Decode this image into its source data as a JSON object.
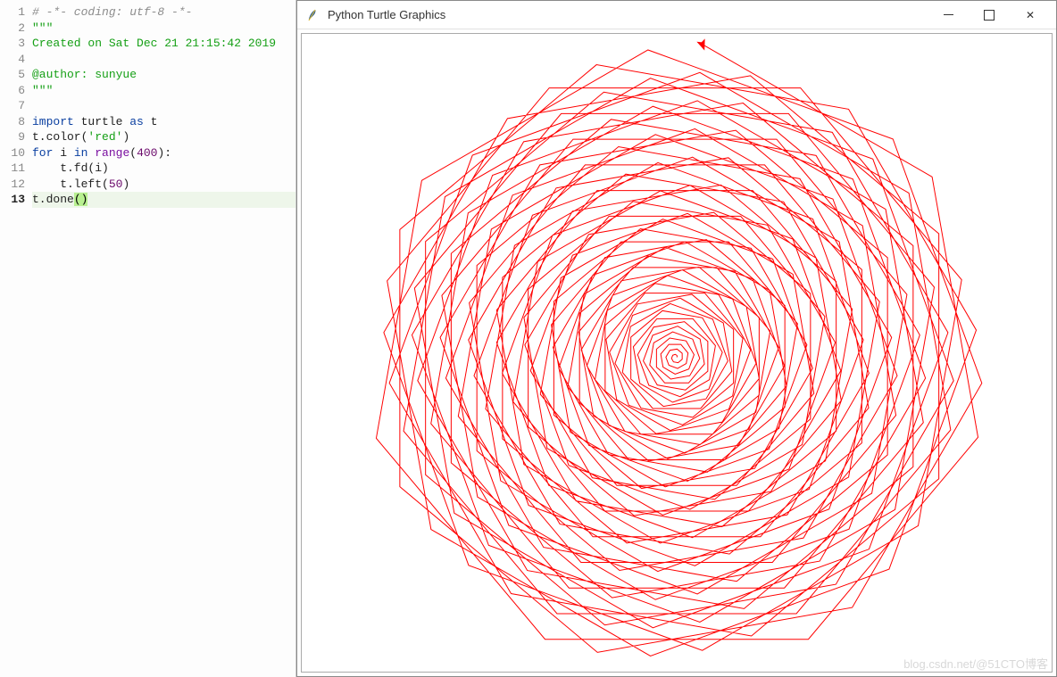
{
  "code": {
    "current_line": 13,
    "lines": [
      {
        "n": 1,
        "segs": [
          {
            "cls": "tk-comment",
            "t": "# -*- coding: utf-8 -*-"
          }
        ]
      },
      {
        "n": 2,
        "segs": [
          {
            "cls": "tk-docstring",
            "t": "\"\"\""
          }
        ]
      },
      {
        "n": 3,
        "segs": [
          {
            "cls": "tk-docstring",
            "t": "Created on Sat Dec 21 21:15:42 2019"
          }
        ]
      },
      {
        "n": 4,
        "segs": []
      },
      {
        "n": 5,
        "segs": [
          {
            "cls": "tk-docstring",
            "t": "@author: sunyue"
          }
        ]
      },
      {
        "n": 6,
        "segs": [
          {
            "cls": "tk-docstring",
            "t": "\"\"\""
          }
        ]
      },
      {
        "n": 7,
        "segs": []
      },
      {
        "n": 8,
        "segs": [
          {
            "cls": "tk-keyword",
            "t": "import"
          },
          {
            "cls": "tk-text",
            "t": " turtle "
          },
          {
            "cls": "tk-keyword",
            "t": "as"
          },
          {
            "cls": "tk-text",
            "t": " t"
          }
        ]
      },
      {
        "n": 9,
        "segs": [
          {
            "cls": "tk-text",
            "t": "t.color("
          },
          {
            "cls": "tk-string",
            "t": "'red'"
          },
          {
            "cls": "tk-text",
            "t": ")"
          }
        ]
      },
      {
        "n": 10,
        "segs": [
          {
            "cls": "tk-keyword",
            "t": "for"
          },
          {
            "cls": "tk-text",
            "t": " i "
          },
          {
            "cls": "tk-keyword",
            "t": "in"
          },
          {
            "cls": "tk-text",
            "t": " "
          },
          {
            "cls": "tk-builtin",
            "t": "range"
          },
          {
            "cls": "tk-text",
            "t": "("
          },
          {
            "cls": "tk-number",
            "t": "400"
          },
          {
            "cls": "tk-text",
            "t": "):"
          }
        ]
      },
      {
        "n": 11,
        "segs": [
          {
            "cls": "tk-text",
            "t": "    t.fd(i)"
          }
        ]
      },
      {
        "n": 12,
        "segs": [
          {
            "cls": "tk-text",
            "t": "    t.left("
          },
          {
            "cls": "tk-number",
            "t": "50"
          },
          {
            "cls": "tk-text",
            "t": ")"
          }
        ]
      },
      {
        "n": 13,
        "segs": [
          {
            "cls": "tk-text",
            "t": "t.done"
          },
          {
            "cls": "tk-paren-match",
            "t": "("
          },
          {
            "cls": "tk-paren-match",
            "t": ")"
          }
        ]
      }
    ]
  },
  "graphics": {
    "title": "Python Turtle Graphics",
    "turtle": {
      "color": "#ff0000",
      "iterations": 400,
      "turn_deg": 50,
      "forward_step": "i"
    }
  },
  "watermark": "blog.csdn.net/@51CTO博客"
}
